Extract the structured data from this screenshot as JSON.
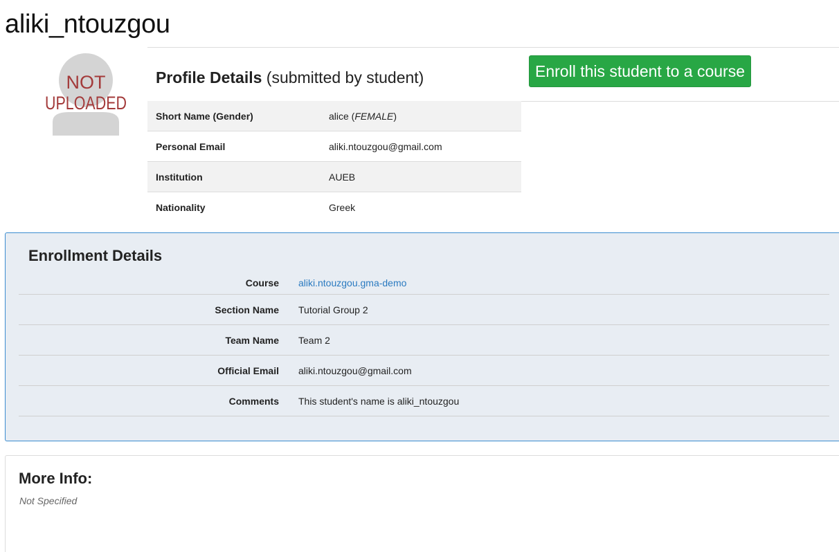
{
  "page": {
    "title": "aliki_ntouzgou"
  },
  "avatar": {
    "line1": "NOT",
    "line2": "UPLOADED",
    "color": "#a33a3a"
  },
  "profile": {
    "heading_bold": "Profile Details",
    "heading_note": "(submitted by student)",
    "enroll_button_label": "Enroll this student to a course",
    "rows": [
      {
        "label": "Short Name (Gender)",
        "value": "alice",
        "gender": "FEMALE"
      },
      {
        "label": "Personal Email",
        "value": "aliki.ntouzgou@gmail.com"
      },
      {
        "label": "Institution",
        "value": "AUEB"
      },
      {
        "label": "Nationality",
        "value": "Greek"
      }
    ]
  },
  "enrollment": {
    "heading": "Enrollment Details",
    "rows": [
      {
        "label": "Course",
        "value": "aliki.ntouzgou.gma-demo"
      },
      {
        "label": "Section Name",
        "value": "Tutorial Group 2"
      },
      {
        "label": "Team Name",
        "value": "Team 2"
      },
      {
        "label": "Official Email",
        "value": "aliki.ntouzgou@gmail.com"
      },
      {
        "label": "Comments",
        "value": "This student's name is aliki_ntouzgou"
      }
    ]
  },
  "more_info": {
    "heading": "More Info:",
    "value": "Not Specified"
  },
  "colors": {
    "enroll_button": "#28a745",
    "link": "#2a7ac0",
    "enrollment_panel_bg": "#e8edf3",
    "enrollment_panel_border": "#3b8ccf"
  }
}
